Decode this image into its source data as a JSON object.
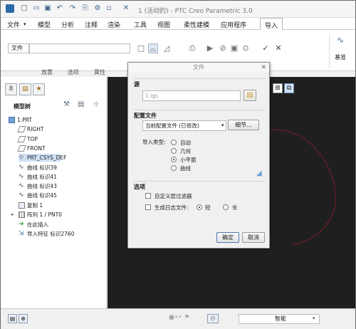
{
  "window_title": "1 (活动的) - PTC Creo Parametric 3.0",
  "menus": [
    "文件",
    "模型",
    "分析",
    "注释",
    "渲染",
    "工具",
    "视图",
    "柔性建模",
    "应用程序",
    "导入"
  ],
  "ribbon": {
    "file_label": "文件",
    "sub_tabs": [
      "放置",
      "选项",
      "属性"
    ],
    "right_group_label": "基准"
  },
  "model_tree": {
    "header": "模型树",
    "items": [
      {
        "label": "1.PRT",
        "icon": "part-icon"
      },
      {
        "label": "RIGHT",
        "icon": "datum-plane-icon"
      },
      {
        "label": "TOP",
        "icon": "datum-plane-icon"
      },
      {
        "label": "FRONT",
        "icon": "datum-plane-icon"
      },
      {
        "label": "PRT_CSYS_DEF",
        "icon": "csys-icon"
      },
      {
        "label": "曲线 标识39",
        "icon": "curve-icon"
      },
      {
        "label": "曲线 标识41",
        "icon": "curve-icon"
      },
      {
        "label": "曲线 标识43",
        "icon": "curve-icon"
      },
      {
        "label": "曲线 标识45",
        "icon": "curve-icon"
      },
      {
        "label": "复制 1",
        "icon": "copy-icon"
      },
      {
        "label": "阵列 1 / PNT0",
        "icon": "pattern-icon"
      },
      {
        "label": "在此插入",
        "icon": "insert-arrow-icon"
      },
      {
        "label": "导入特征 标识2760",
        "icon": "import-feature-icon"
      }
    ]
  },
  "dialog": {
    "title": "文件",
    "source_section": "源",
    "file_value": "1.igs",
    "config_section": "配置文件",
    "config_value": "当前配置文件 (已修改)",
    "detail_button": "细节...",
    "import_type_label": "导入类型:",
    "import_types": [
      "自动",
      "几何",
      "小平面",
      "曲线"
    ],
    "selected_import_type": "小平面",
    "options_section": "选项",
    "custom_filter_label": "自定义层过滤器",
    "log_file_label": "生成日志文件:",
    "log_options": [
      "短",
      "长"
    ],
    "selected_log": "短",
    "ok_button": "确定",
    "cancel_button": "取消"
  },
  "status_bar": {
    "filter_value": "智能"
  },
  "colors": {
    "accent": "#2b6aa8",
    "canvas_bg": "#1f1f1f",
    "curve": "#b11a2d"
  }
}
